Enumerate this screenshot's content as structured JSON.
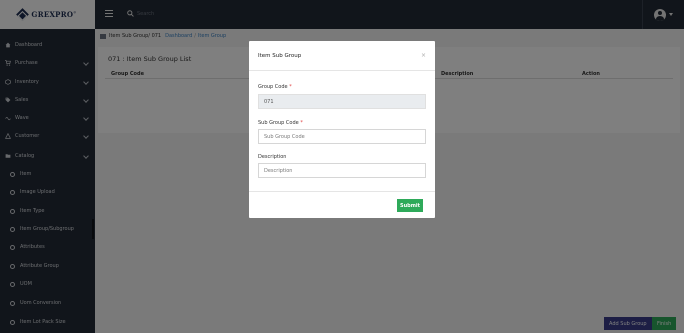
{
  "brand": {
    "name": "GREXPRO",
    "mark": "®"
  },
  "topbar": {
    "search_placeholder": "Search"
  },
  "sidebar": {
    "items": [
      {
        "label": "Dashboard",
        "icon": "home-icon",
        "chevron": false
      },
      {
        "label": "Purchase",
        "icon": "cart-icon",
        "chevron": true
      },
      {
        "label": "Inventory",
        "icon": "box-icon",
        "chevron": true
      },
      {
        "label": "Sales",
        "icon": "tag-icon",
        "chevron": true
      },
      {
        "label": "Wave",
        "icon": "wave-icon",
        "chevron": true
      },
      {
        "label": "Customer",
        "icon": "user-icon",
        "chevron": true
      },
      {
        "label": "Catalog",
        "icon": "folder-icon",
        "chevron": true
      }
    ],
    "sub_items": [
      {
        "label": "Item"
      },
      {
        "label": "Image Upload"
      },
      {
        "label": "Item Type"
      },
      {
        "label": "Item Group/Subgroup"
      },
      {
        "label": "Attributes"
      },
      {
        "label": "Attribute Group"
      },
      {
        "label": "UOM"
      },
      {
        "label": "Uom Conversion"
      },
      {
        "label": "Item Lot Pack Size"
      }
    ]
  },
  "breadcrumb": {
    "title": "Item Sub Group/ 071",
    "links": [
      "Dashboard",
      "Item Group"
    ],
    "separator": "/"
  },
  "page": {
    "list_title": "071 : Item Sub Group List",
    "columns": [
      "Group Code",
      "Description",
      "Action"
    ]
  },
  "footer": {
    "add_label": "Add Sub Group",
    "finish_label": "Finish"
  },
  "modal": {
    "title": "Item Sub Group",
    "close": "×",
    "group_code_label": "Group Code",
    "group_code_value": "071",
    "sub_group_code_label": "Sub Group Code",
    "sub_group_code_placeholder": "Sub Group Code",
    "description_label": "Description",
    "description_placeholder": "Description",
    "required_mark": "*",
    "submit_label": "Submit"
  },
  "colors": {
    "sidebar_bg": "#232a36",
    "link": "#3b82c4",
    "submit": "#2eaa5a",
    "add_button": "#3a3d8a",
    "finish_button": "#2eaa5a",
    "required": "#e04040"
  }
}
